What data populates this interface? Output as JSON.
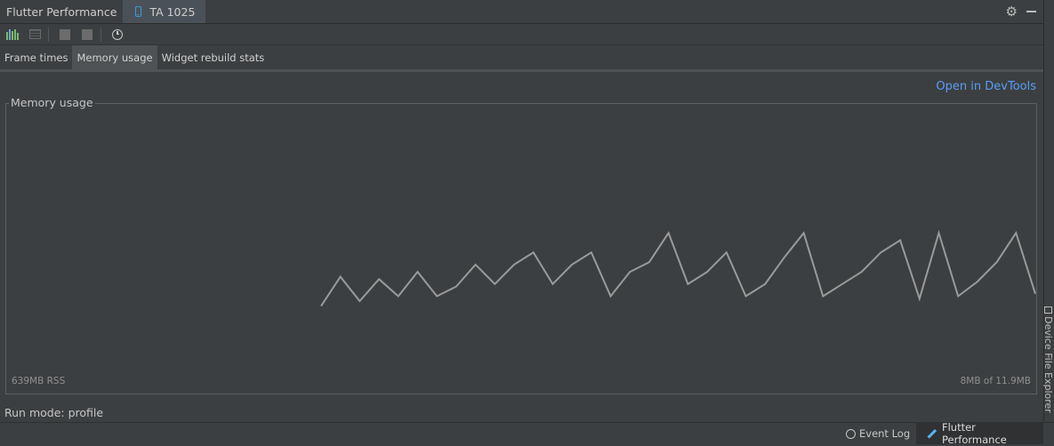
{
  "title_bar": {
    "tool_window_title": "Flutter Performance",
    "device_tab_label": "TA 1025"
  },
  "toolbar": {
    "icons": [
      "performance-bars-icon",
      "performance-overlay-icon",
      "stop-icon",
      "debug-paint-icon",
      "clock-icon"
    ]
  },
  "tabs": [
    {
      "label": "Frame times",
      "active": false
    },
    {
      "label": "Memory usage",
      "active": true
    },
    {
      "label": "Widget rebuild stats",
      "active": false
    }
  ],
  "main": {
    "devtools_link": "Open in DevTools",
    "memory_panel_title": "Memory usage",
    "rss_label": "639MB RSS",
    "heap_label": "8MB of 11.9MB",
    "run_mode": "Run mode: profile"
  },
  "chart_data": {
    "type": "line",
    "title": "",
    "xlabel": "",
    "ylabel": "",
    "ylim": [
      0,
      11.9
    ],
    "series": [
      {
        "values": [
          3.6,
          4.8,
          3.8,
          4.7,
          4.0,
          5.0,
          4.0,
          4.4,
          5.3,
          4.5,
          5.3,
          5.8,
          4.5,
          5.3,
          5.8,
          4.0,
          5.0,
          5.4,
          6.6,
          4.5,
          5.0,
          5.8,
          4.0,
          4.5,
          5.6,
          6.6,
          4.0,
          4.5,
          5.0,
          5.8,
          6.3,
          3.9,
          6.6,
          4.0,
          4.6,
          5.4,
          6.6,
          4.1
        ]
      }
    ],
    "color": "#9a9a9a"
  },
  "status_bar": {
    "event_log_label": "Event Log",
    "flutter_performance_label": "Flutter Performance"
  },
  "side_strip": {
    "device_file_explorer_label": "Device File Explorer"
  }
}
